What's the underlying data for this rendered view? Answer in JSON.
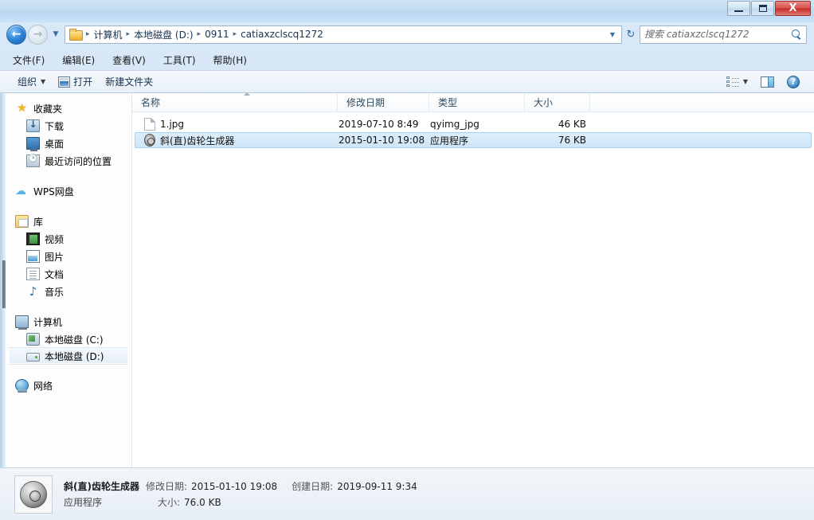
{
  "window": {
    "controls": {
      "minimize_label": "–",
      "maximize_label": "□",
      "close_label": "X"
    }
  },
  "address_bar": {
    "back_label": "←",
    "forward_label": "→",
    "history_dropdown_label": "▼",
    "breadcrumbs": [
      {
        "label": "计算机"
      },
      {
        "label": "本地磁盘 (D:)"
      },
      {
        "label": "0911"
      },
      {
        "label": "catiaxzclscq1272"
      }
    ],
    "separator": "▸",
    "address_dropdown_label": "▼",
    "refresh_label": "↻"
  },
  "search": {
    "placeholder": "搜索 catiaxzclscq1272",
    "value": ""
  },
  "menu": {
    "items": [
      {
        "label": "文件(F)"
      },
      {
        "label": "编辑(E)"
      },
      {
        "label": "查看(V)"
      },
      {
        "label": "工具(T)"
      },
      {
        "label": "帮助(H)"
      }
    ]
  },
  "toolbar": {
    "organize_label": "组织",
    "organize_caret": "▼",
    "open_label": "打开",
    "new_folder_label": "新建文件夹",
    "view_caret": "▼",
    "help_label": "?"
  },
  "sidebar": {
    "items": [
      {
        "label": "收藏夹",
        "icon": "star-icon",
        "level": "root",
        "selected": false
      },
      {
        "label": "下载",
        "icon": "download-icon",
        "level": "child",
        "selected": false
      },
      {
        "label": "桌面",
        "icon": "desktop-icon",
        "level": "child",
        "selected": false
      },
      {
        "label": "最近访问的位置",
        "icon": "recent-places-icon",
        "level": "child",
        "selected": false
      },
      {
        "label": "WPS网盘",
        "icon": "cloud-icon",
        "level": "root",
        "selected": false
      },
      {
        "label": "库",
        "icon": "library-icon",
        "level": "root",
        "selected": false
      },
      {
        "label": "视频",
        "icon": "video-icon",
        "level": "child",
        "selected": false
      },
      {
        "label": "图片",
        "icon": "picture-icon",
        "level": "child",
        "selected": false
      },
      {
        "label": "文档",
        "icon": "document-icon",
        "level": "child",
        "selected": false
      },
      {
        "label": "音乐",
        "icon": "music-icon",
        "level": "child",
        "selected": false
      },
      {
        "label": "计算机",
        "icon": "computer-icon",
        "level": "root",
        "selected": false
      },
      {
        "label": "本地磁盘 (C:)",
        "icon": "drive-c-icon",
        "level": "child",
        "selected": false
      },
      {
        "label": "本地磁盘 (D:)",
        "icon": "drive-d-icon",
        "level": "child",
        "selected": true
      },
      {
        "label": "网络",
        "icon": "network-icon",
        "level": "root",
        "selected": false
      }
    ]
  },
  "file_list": {
    "columns": [
      {
        "label": "名称",
        "key": "name"
      },
      {
        "label": "修改日期",
        "key": "date"
      },
      {
        "label": "类型",
        "key": "type"
      },
      {
        "label": "大小",
        "key": "size"
      }
    ],
    "sort_column": "名称",
    "sort_direction": "asc",
    "rows": [
      {
        "name": "1.jpg",
        "date": "2019-07-10 8:49",
        "type": "qyimg_jpg",
        "size": "46 KB",
        "icon": "jpg-file-icon",
        "selected": false
      },
      {
        "name": "斜(直)齿轮生成器",
        "date": "2015-01-10 19:08",
        "type": "应用程序",
        "size": "76 KB",
        "icon": "application-exe-icon",
        "selected": true
      }
    ]
  },
  "status_bar": {
    "icon": "gear-wheel-icon",
    "file_name": "斜(直)齿轮生成器",
    "modified_label": "修改日期:",
    "modified_value": "2015-01-10 19:08",
    "created_label": "创建日期:",
    "created_value": "2019-09-11 9:34",
    "file_type": "应用程序",
    "size_label": "大小:",
    "size_value": "76.0 KB"
  },
  "colors": {
    "title_bar": "#c3dbf2",
    "selection": "#cfe6f8",
    "selection_border": "#a9cfeb",
    "close_button": "#c32d26",
    "accent": "#2a6ca8"
  }
}
